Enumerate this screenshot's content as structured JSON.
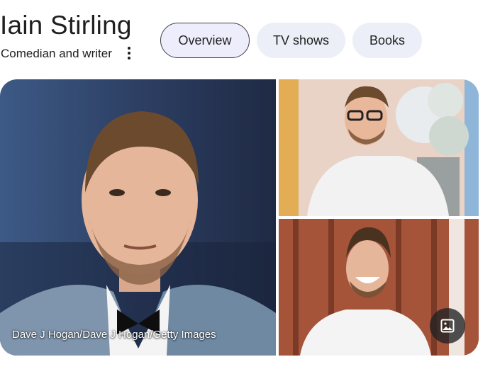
{
  "entity": {
    "name": "Iain Stirling",
    "description": "Comedian and writer"
  },
  "tabs": [
    {
      "label": "Overview",
      "active": true
    },
    {
      "label": "TV shows",
      "active": false
    },
    {
      "label": "Books",
      "active": false
    }
  ],
  "images": {
    "credit": "Dave J Hogan/Dave J Hogan/Getty Images"
  },
  "icons": {
    "more": "more-vertical-icon",
    "gallery": "image-gallery-icon"
  },
  "colors": {
    "chip_bg": "#eceff8",
    "chip_active_bg": "#eeedfc",
    "text": "#1f1f1f"
  }
}
